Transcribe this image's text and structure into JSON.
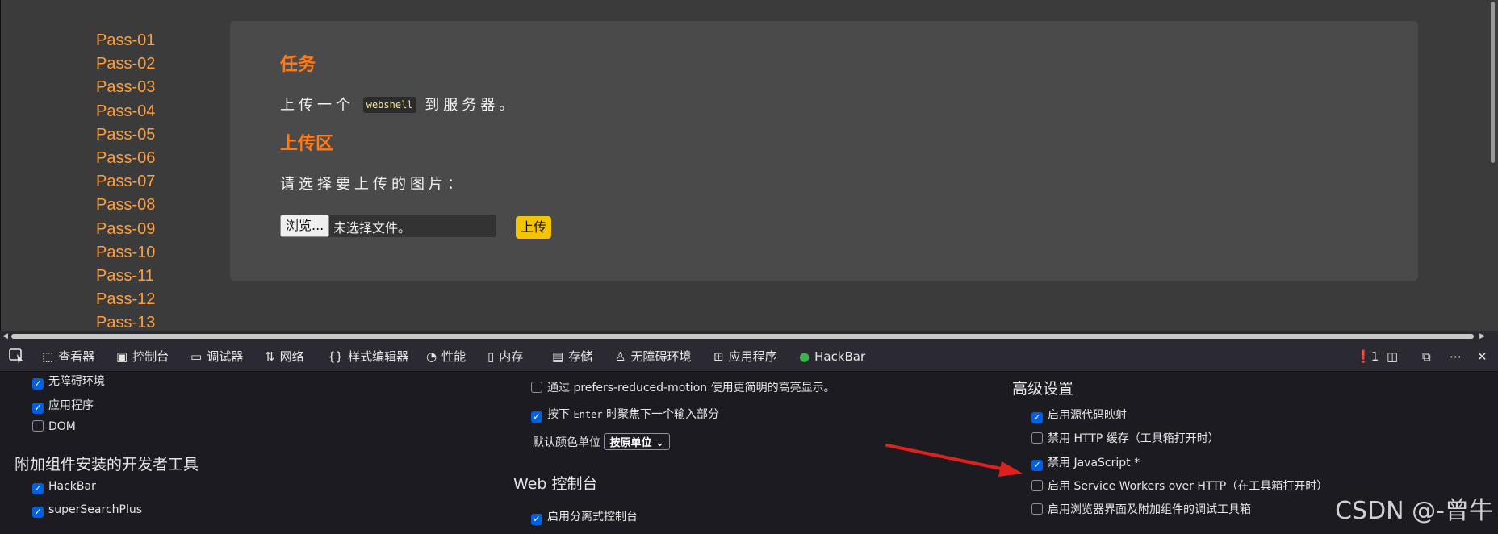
{
  "sidebar": {
    "items": [
      "Pass-01",
      "Pass-02",
      "Pass-03",
      "Pass-04",
      "Pass-05",
      "Pass-06",
      "Pass-07",
      "Pass-08",
      "Pass-09",
      "Pass-10",
      "Pass-11",
      "Pass-12",
      "Pass-13"
    ]
  },
  "main": {
    "task_heading": "任务",
    "task_text_before": "上传一个",
    "task_code": "webshell",
    "task_text_after": "到服务器。",
    "upload_heading": "上传区",
    "prompt": "请选择要上传的图片：",
    "browse_label": "浏览...",
    "no_file_text": "未选择文件。",
    "upload_label": "上传"
  },
  "devtools": {
    "tabs": [
      {
        "icon": "inspector-icon",
        "label": "查看器"
      },
      {
        "icon": "console-icon",
        "label": "控制台"
      },
      {
        "icon": "debugger-icon",
        "label": "调试器"
      },
      {
        "icon": "network-icon",
        "label": "网络"
      },
      {
        "icon": "style-editor-icon",
        "label": "样式编辑器"
      },
      {
        "icon": "performance-icon",
        "label": "性能"
      },
      {
        "icon": "memory-icon",
        "label": "内存"
      },
      {
        "icon": "storage-icon",
        "label": "存储"
      },
      {
        "icon": "accessibility-icon",
        "label": "无障碍环境"
      },
      {
        "icon": "application-icon",
        "label": "应用程序"
      },
      {
        "icon": "hackbar-icon",
        "label": "HackBar"
      }
    ],
    "error_count": "1"
  },
  "settings": {
    "col1": {
      "items": [
        {
          "label": "无障碍环境",
          "checked": true
        },
        {
          "label": "应用程序",
          "checked": true
        },
        {
          "label": "DOM",
          "checked": false
        }
      ],
      "addons_heading": "附加组件安装的开发者工具",
      "addons": [
        {
          "label": "HackBar",
          "checked": true
        },
        {
          "label": "superSearchPlus",
          "checked": true
        }
      ]
    },
    "col2": {
      "reduced_motion": {
        "label": "通过 prefers-reduced-motion 使用更简明的高亮显示。",
        "checked": false
      },
      "enter_focus": {
        "label_before": "按下",
        "label_code": "Enter",
        "label_after": "时聚焦下一个输入部分",
        "checked": true
      },
      "color_unit_label": "默认颜色单位",
      "color_unit_value": "按原单位",
      "webconsole_heading": "Web 控制台",
      "split_console": {
        "label": "启用分离式控制台",
        "checked": true
      }
    },
    "col3": {
      "heading": "高级设置",
      "items": [
        {
          "label": "启用源代码映射",
          "checked": true
        },
        {
          "label": "禁用 HTTP 缓存（工具箱打开时）",
          "checked": false
        },
        {
          "label": "禁用 JavaScript *",
          "checked": true
        },
        {
          "label": "启用 Service Workers over HTTP（在工具箱打开时）",
          "checked": false
        },
        {
          "label": "启用浏览器界面及附加组件的调试工具箱",
          "checked": false
        }
      ]
    }
  },
  "watermark": "CSDN @-曾牛",
  "colors": {
    "accent_orange": "#ff9e3d",
    "heading_orange": "#ff7a1a",
    "checkbox_blue": "#0060df",
    "arrow_red": "#e0201c"
  }
}
